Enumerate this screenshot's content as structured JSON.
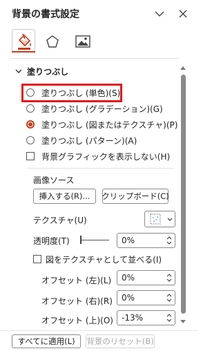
{
  "header": {
    "title": "背景の書式設定",
    "collapse_icon": "chevron-down-icon",
    "close_icon": "close-icon"
  },
  "tabs": [
    {
      "name": "fill",
      "icon": "paint-bucket-icon",
      "active": true
    },
    {
      "name": "effects",
      "icon": "pentagon-icon",
      "active": false
    },
    {
      "name": "picture",
      "icon": "picture-icon",
      "active": false
    }
  ],
  "fill_section": {
    "title": "塗りつぶし",
    "options": [
      {
        "label": "塗りつぶし (単色)(S)",
        "checked": false,
        "highlighted": true
      },
      {
        "label": "塗りつぶし (グラデーション)(G)",
        "checked": false
      },
      {
        "label": "塗りつぶし (図またはテクスチャ)(P)",
        "checked": true
      },
      {
        "label": "塗りつぶし (パターン)(A)",
        "checked": false
      }
    ],
    "hide_bg_graphics": "背景グラフィックを表示しない(H)"
  },
  "picture_source": {
    "label": "画像ソース",
    "insert_button": "挿入する(R)...",
    "clipboard_button": "クリップボード(C)"
  },
  "texture": {
    "label": "テクスチャ(U)"
  },
  "transparency": {
    "label": "透明度(T)",
    "value": "0%",
    "slider_value": 0
  },
  "tile": {
    "label": "図をテクスチャとして並べる(I)",
    "checked": false
  },
  "offsets": [
    {
      "label": "オフセット (左)(L)",
      "value": "0%"
    },
    {
      "label": "オフセット (右)(R)",
      "value": "0%"
    },
    {
      "label": "オフセット (上)(O)",
      "value": "-13%"
    }
  ],
  "footer": {
    "apply_all": "すべてに適用(L)",
    "reset": "背景のリセット(B)"
  },
  "colors": {
    "accent": "#c43e1c",
    "highlight_box": "#e3161e"
  }
}
